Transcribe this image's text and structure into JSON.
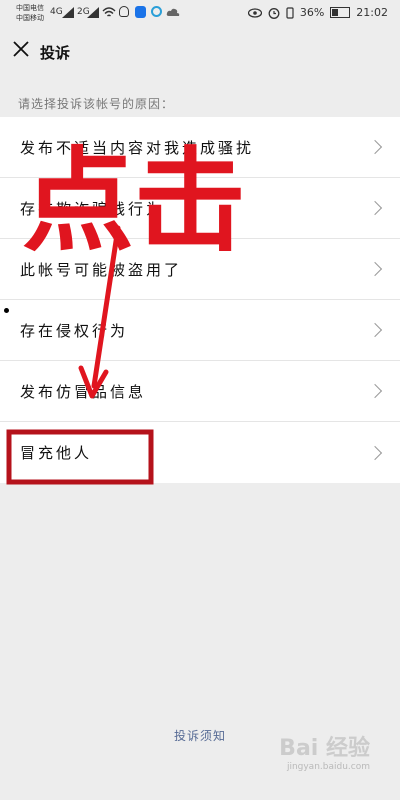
{
  "status_bar": {
    "carrier1": "中国电信",
    "carrier2": "中国移动",
    "net1": "4G",
    "net2": "2G",
    "battery": "36%",
    "time": "21:02"
  },
  "header": {
    "title": "投诉"
  },
  "prompt": "请选择投诉该帐号的原因：",
  "items": [
    {
      "label": "发布不适当内容对我造成骚扰"
    },
    {
      "label": "存在欺诈骗钱行为"
    },
    {
      "label": "此帐号可能被盗用了"
    },
    {
      "label": "存在侵权行为"
    },
    {
      "label": "发布仿冒品信息"
    },
    {
      "label": "冒充他人"
    }
  ],
  "notice_link": "投诉须知",
  "annotation": {
    "text": "点击",
    "color": "#e0151f"
  },
  "watermark": {
    "brand": "Bai 经验",
    "url": "jingyan.baidu.com"
  }
}
